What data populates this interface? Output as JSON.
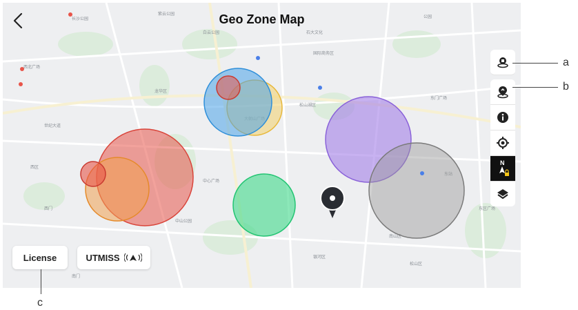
{
  "header": {
    "title": "Geo Zone Map",
    "back_icon": "chevron-left-icon"
  },
  "toolbar": {
    "items": [
      {
        "name": "unlock-zone-icon",
        "dark": false
      },
      {
        "name": "custom-unlock-icon",
        "dark": false
      },
      {
        "name": "info-icon",
        "dark": false
      },
      {
        "name": "locate-icon",
        "dark": false
      },
      {
        "name": "north-lock-icon",
        "dark": true
      },
      {
        "name": "layers-icon",
        "dark": false
      }
    ]
  },
  "bottom": {
    "license_label": "License",
    "utmiss_label": "UTMISS",
    "utmiss_icon": "broadcast-icon"
  },
  "callouts": {
    "a": "a",
    "b": "b",
    "c": "c"
  },
  "colors": {
    "red_zone": "#e8554a",
    "orange_zone": "#f0a050",
    "blue_zone": "#4aa3e8",
    "yellow_zone": "#f2cf6a",
    "purple_zone": "#a37ee8",
    "gray_zone": "#9a9a9a",
    "green_zone": "#3fd98a",
    "dark_button": "#111111"
  }
}
